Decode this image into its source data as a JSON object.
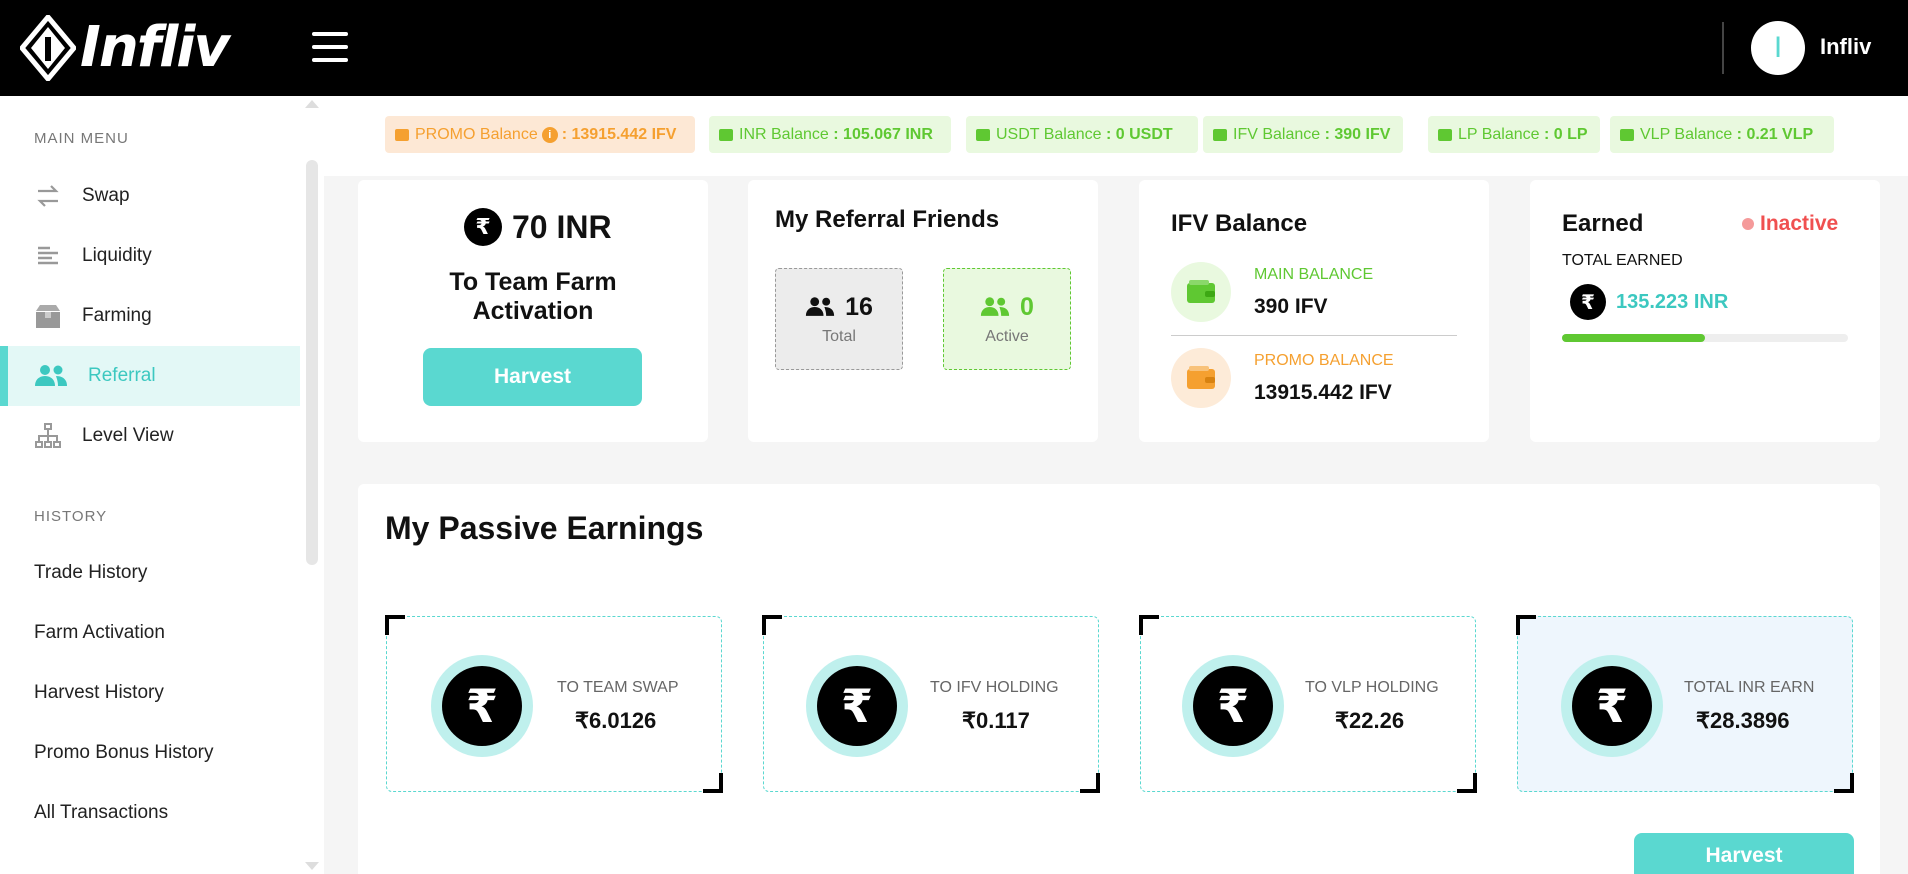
{
  "header": {
    "logo_text": "Infliv",
    "username": "Infliv",
    "avatar_initial": "I"
  },
  "sidebar": {
    "main_menu_title": "MAIN MENU",
    "items": [
      {
        "label": "Swap",
        "icon": "swap-icon"
      },
      {
        "label": "Liquidity",
        "icon": "liquidity-icon"
      },
      {
        "label": "Farming",
        "icon": "farming-icon"
      },
      {
        "label": "Referral",
        "icon": "users-icon",
        "active": true
      },
      {
        "label": "Level View",
        "icon": "hierarchy-icon"
      }
    ],
    "history_title": "HISTORY",
    "history_items": [
      "Trade History",
      "Farm Activation",
      "Harvest History",
      "Promo Bonus History",
      "All Transactions"
    ]
  },
  "balances": {
    "promo_label": "PROMO Balance",
    "promo_value": ": 13915.442 IFV",
    "inr_label": "INR Balance",
    "inr_value": ": 105.067 INR",
    "usdt_label": "USDT Balance",
    "usdt_value": ": 0 USDT",
    "ifv_label": "IFV Balance",
    "ifv_value": ": 390 IFV",
    "lp_label": "LP Balance",
    "lp_value": ": 0 LP",
    "vlp_label": "VLP Balance",
    "vlp_value": ": 0.21 VLP"
  },
  "farm_card": {
    "amount": "70 INR",
    "line1": "To Team Farm",
    "line2": "Activation",
    "button": "Harvest"
  },
  "referral_card": {
    "title": "My Referral Friends",
    "total_count": "16",
    "total_label": "Total",
    "active_count": "0",
    "active_label": "Active"
  },
  "ifv_card": {
    "title": "IFV Balance",
    "main_label": "MAIN BALANCE",
    "main_value": "390 IFV",
    "promo_label": "PROMO BALANCE",
    "promo_value": "13915.442 IFV"
  },
  "earned_card": {
    "title": "Earned",
    "status": "Inactive",
    "total_label": "TOTAL EARNED",
    "total_value": "135.223 INR",
    "progress_fraction": 0.5
  },
  "passive": {
    "title": "My Passive Earnings",
    "cards": [
      {
        "label": "TO TEAM SWAP",
        "value": "₹6.0126"
      },
      {
        "label": "TO IFV HOLDING",
        "value": "₹0.117"
      },
      {
        "label": "TO VLP HOLDING",
        "value": "₹22.26"
      },
      {
        "label": "TOTAL INR EARN",
        "value": "₹28.3896"
      }
    ],
    "button": "Harvest"
  },
  "colors": {
    "accent": "#5ad8d0",
    "green": "#5fc832",
    "orange": "#f5a030",
    "inactive": "#f05050"
  },
  "currency_symbol": "₹"
}
